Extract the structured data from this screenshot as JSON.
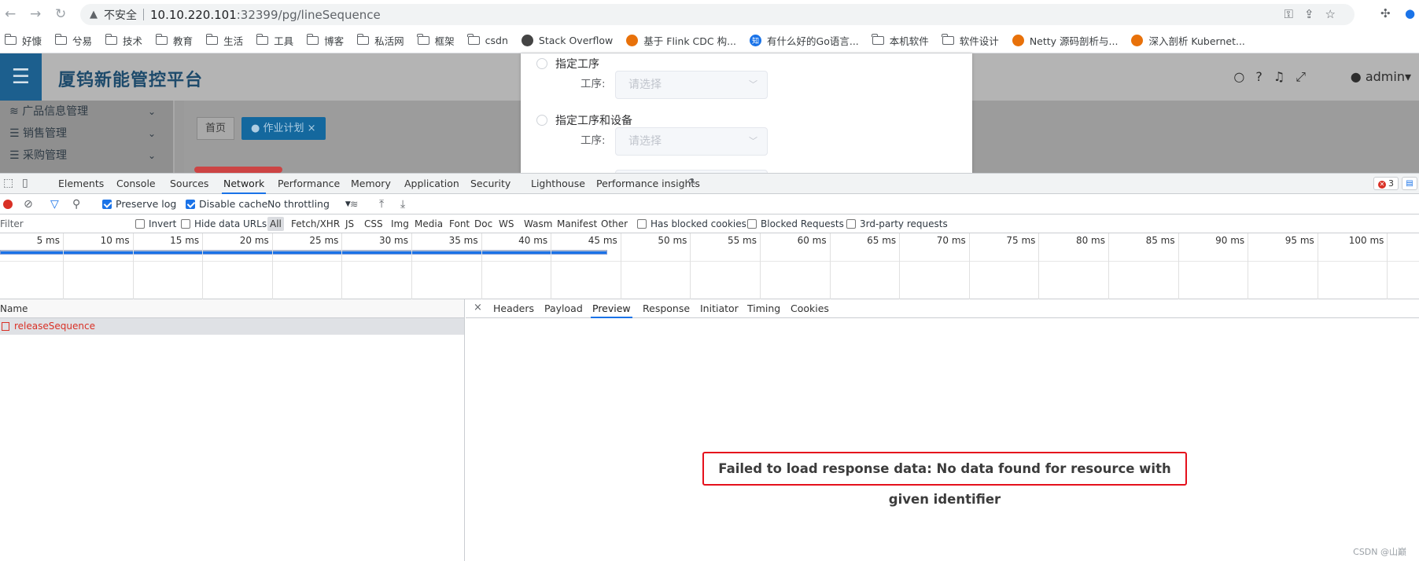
{
  "browser": {
    "insecure_label": "不安全",
    "url_host": "10.10.220.101",
    "url_rest": ":32399/pg/lineSequence"
  },
  "bookmarks": [
    {
      "label": "好慷",
      "icon": "folder-icon"
    },
    {
      "label": "兮易",
      "icon": "folder-icon"
    },
    {
      "label": "技术",
      "icon": "folder-icon"
    },
    {
      "label": "教育",
      "icon": "folder-icon"
    },
    {
      "label": "生活",
      "icon": "folder-icon"
    },
    {
      "label": "工具",
      "icon": "folder-icon"
    },
    {
      "label": "博客",
      "icon": "folder-icon"
    },
    {
      "label": "私活网",
      "icon": "folder-icon"
    },
    {
      "label": "框架",
      "icon": "folder-icon"
    },
    {
      "label": "csdn",
      "icon": "folder-icon"
    },
    {
      "label": "Stack Overflow",
      "icon": "globe-icon"
    },
    {
      "label": "基于 Flink CDC 构...",
      "icon": "site-icon"
    },
    {
      "label": "有什么好的Go语言...",
      "icon": "zhihu-icon"
    },
    {
      "label": "本机软件",
      "icon": "folder-icon"
    },
    {
      "label": "软件设计",
      "icon": "folder-icon"
    },
    {
      "label": "Netty 源码剖析与...",
      "icon": "site-icon"
    },
    {
      "label": "深入剖析 Kubernet...",
      "icon": "site-icon"
    }
  ],
  "app": {
    "brand": "厦钨新能管控平台",
    "menu": [
      "广品信息管理",
      "销售管理",
      "采购管理"
    ],
    "tabs": {
      "home": "首页",
      "plan": "作业计划"
    },
    "user": "admin"
  },
  "modal": {
    "option1": "指定工序",
    "option2": "指定工序和设备",
    "field_label": "工序:",
    "placeholder": "请选择"
  },
  "devtools": {
    "tabs": [
      "Elements",
      "Console",
      "Sources",
      "Network",
      "Performance",
      "Memory",
      "Application",
      "Security",
      "Lighthouse",
      "Performance insights"
    ],
    "active_tab": "Network",
    "error_count": "3",
    "toolbar": {
      "preserve_log": "Preserve log",
      "disable_cache": "Disable cache",
      "throttling": "No throttling"
    },
    "filter": {
      "placeholder": "Filter",
      "invert": "Invert",
      "hide_data_urls": "Hide data URLs",
      "types": [
        "All",
        "Fetch/XHR",
        "JS",
        "CSS",
        "Img",
        "Media",
        "Font",
        "Doc",
        "WS",
        "Wasm",
        "Manifest",
        "Other"
      ],
      "has_blocked_cookies": "Has blocked cookies",
      "blocked_requests": "Blocked Requests",
      "third_party": "3rd-party requests"
    },
    "timeline_ticks": [
      "5 ms",
      "10 ms",
      "15 ms",
      "20 ms",
      "25 ms",
      "30 ms",
      "35 ms",
      "40 ms",
      "45 ms",
      "50 ms",
      "55 ms",
      "60 ms",
      "65 ms",
      "70 ms",
      "75 ms",
      "80 ms",
      "85 ms",
      "90 ms",
      "95 ms",
      "100 ms"
    ],
    "name_header": "Name",
    "request": "releaseSequence",
    "detail_tabs": [
      "Headers",
      "Payload",
      "Preview",
      "Response",
      "Initiator",
      "Timing",
      "Cookies"
    ],
    "active_detail_tab": "Preview",
    "error_message": "Failed to load response data: No data found for resource with given identifier"
  },
  "watermark": "CSDN @山巅"
}
